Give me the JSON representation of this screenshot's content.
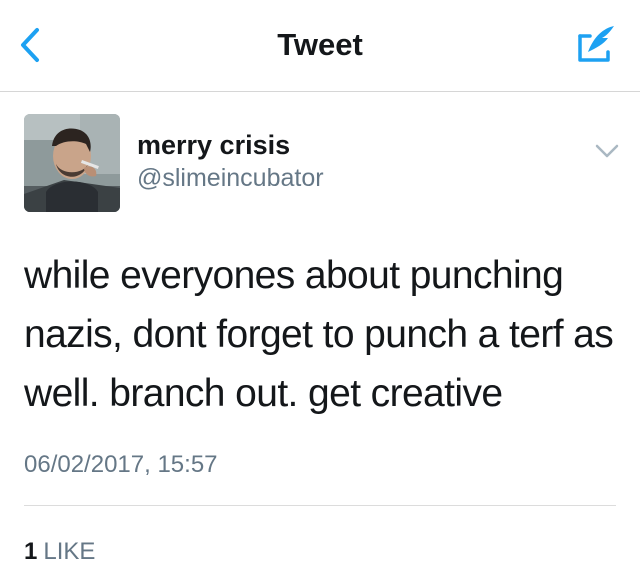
{
  "nav": {
    "title": "Tweet",
    "back_icon": "chevron-left-icon",
    "compose_icon": "compose-quill-icon",
    "accent_color": "#1da1f2"
  },
  "tweet": {
    "author_name": "merry crisis",
    "author_handle": "@slimeincubator",
    "text": "while everyones about punching nazis, dont forget to punch a terf as well. branch out. get creative",
    "timestamp": "06/02/2017, 15:57",
    "like_count": "1",
    "like_label": "LIKE",
    "menu_icon": "chevron-down-icon"
  },
  "colors": {
    "primary_text": "#14171a",
    "secondary_text": "#657786",
    "divider": "#dcdcdc"
  }
}
